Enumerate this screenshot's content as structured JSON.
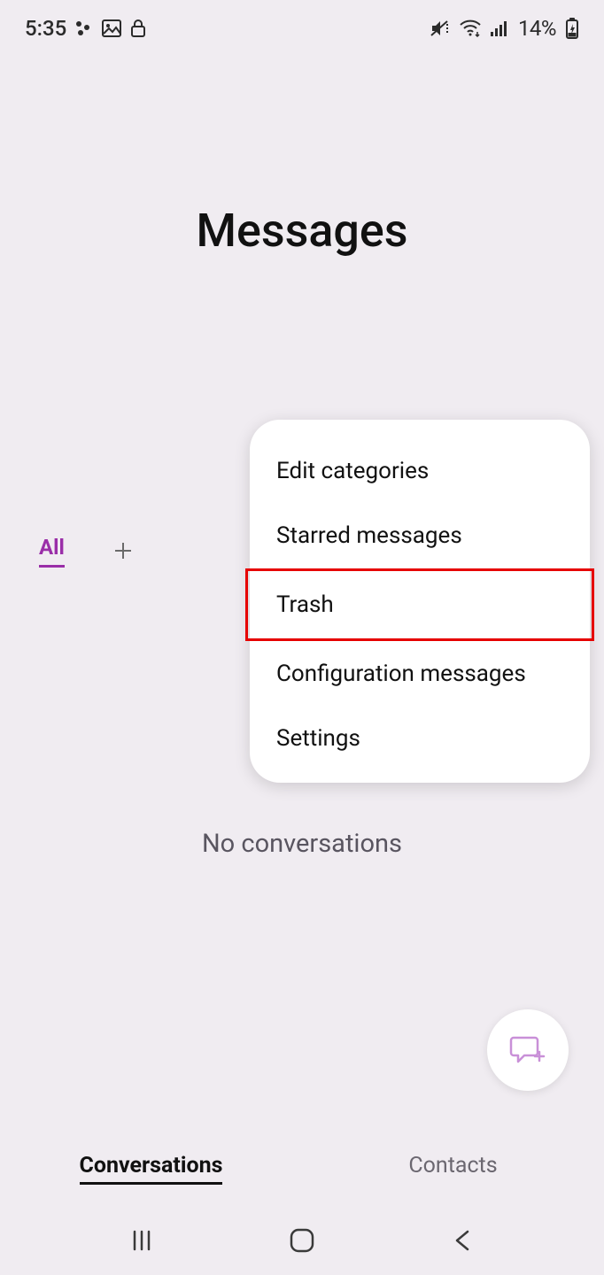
{
  "status": {
    "time": "5:35",
    "battery_text": "14%"
  },
  "title": "Messages",
  "tabs": {
    "all": "All"
  },
  "menu": {
    "items": [
      "Edit categories",
      "Starred messages",
      "Trash",
      "Configuration messages",
      "Settings"
    ],
    "highlight_index": 2
  },
  "empty_state": "No conversations",
  "bottom_tabs": {
    "conversations": "Conversations",
    "contacts": "Contacts"
  }
}
